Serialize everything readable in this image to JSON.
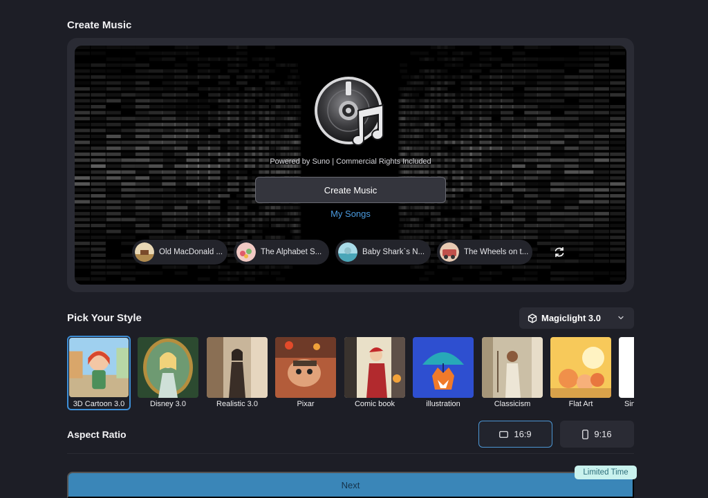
{
  "create_music": {
    "title": "Create Music",
    "powered_by": "Powered by Suno | Commercial Rights Included",
    "create_button": "Create Music",
    "my_songs": "My Songs",
    "songs": [
      {
        "label": "Old MacDonald ..."
      },
      {
        "label": "The Alphabet S..."
      },
      {
        "label": "Baby Shark`s N..."
      },
      {
        "label": "The Wheels on t..."
      }
    ],
    "refresh_icon": "refresh-icon"
  },
  "pick_style": {
    "title": "Pick Your Style",
    "model": "Magiclight 3.0",
    "styles": [
      {
        "label": "3D Cartoon 3.0",
        "selected": true
      },
      {
        "label": "Disney 3.0"
      },
      {
        "label": "Realistic 3.0"
      },
      {
        "label": "Pixar"
      },
      {
        "label": "Comic book"
      },
      {
        "label": "illustration"
      },
      {
        "label": "Classicism"
      },
      {
        "label": "Flat Art"
      },
      {
        "label": "Sin"
      }
    ]
  },
  "aspect_ratio": {
    "title": "Aspect Ratio",
    "options": [
      {
        "label": "16:9",
        "selected": true
      },
      {
        "label": "9:16"
      }
    ]
  },
  "footer": {
    "next": "Next",
    "badge": "Limited Time"
  },
  "colors": {
    "background": "#1d1e26",
    "accent": "#3d8fd8",
    "link": "#4b9be0",
    "next_button": "#3a86b8",
    "badge": "#c9f2ee"
  }
}
